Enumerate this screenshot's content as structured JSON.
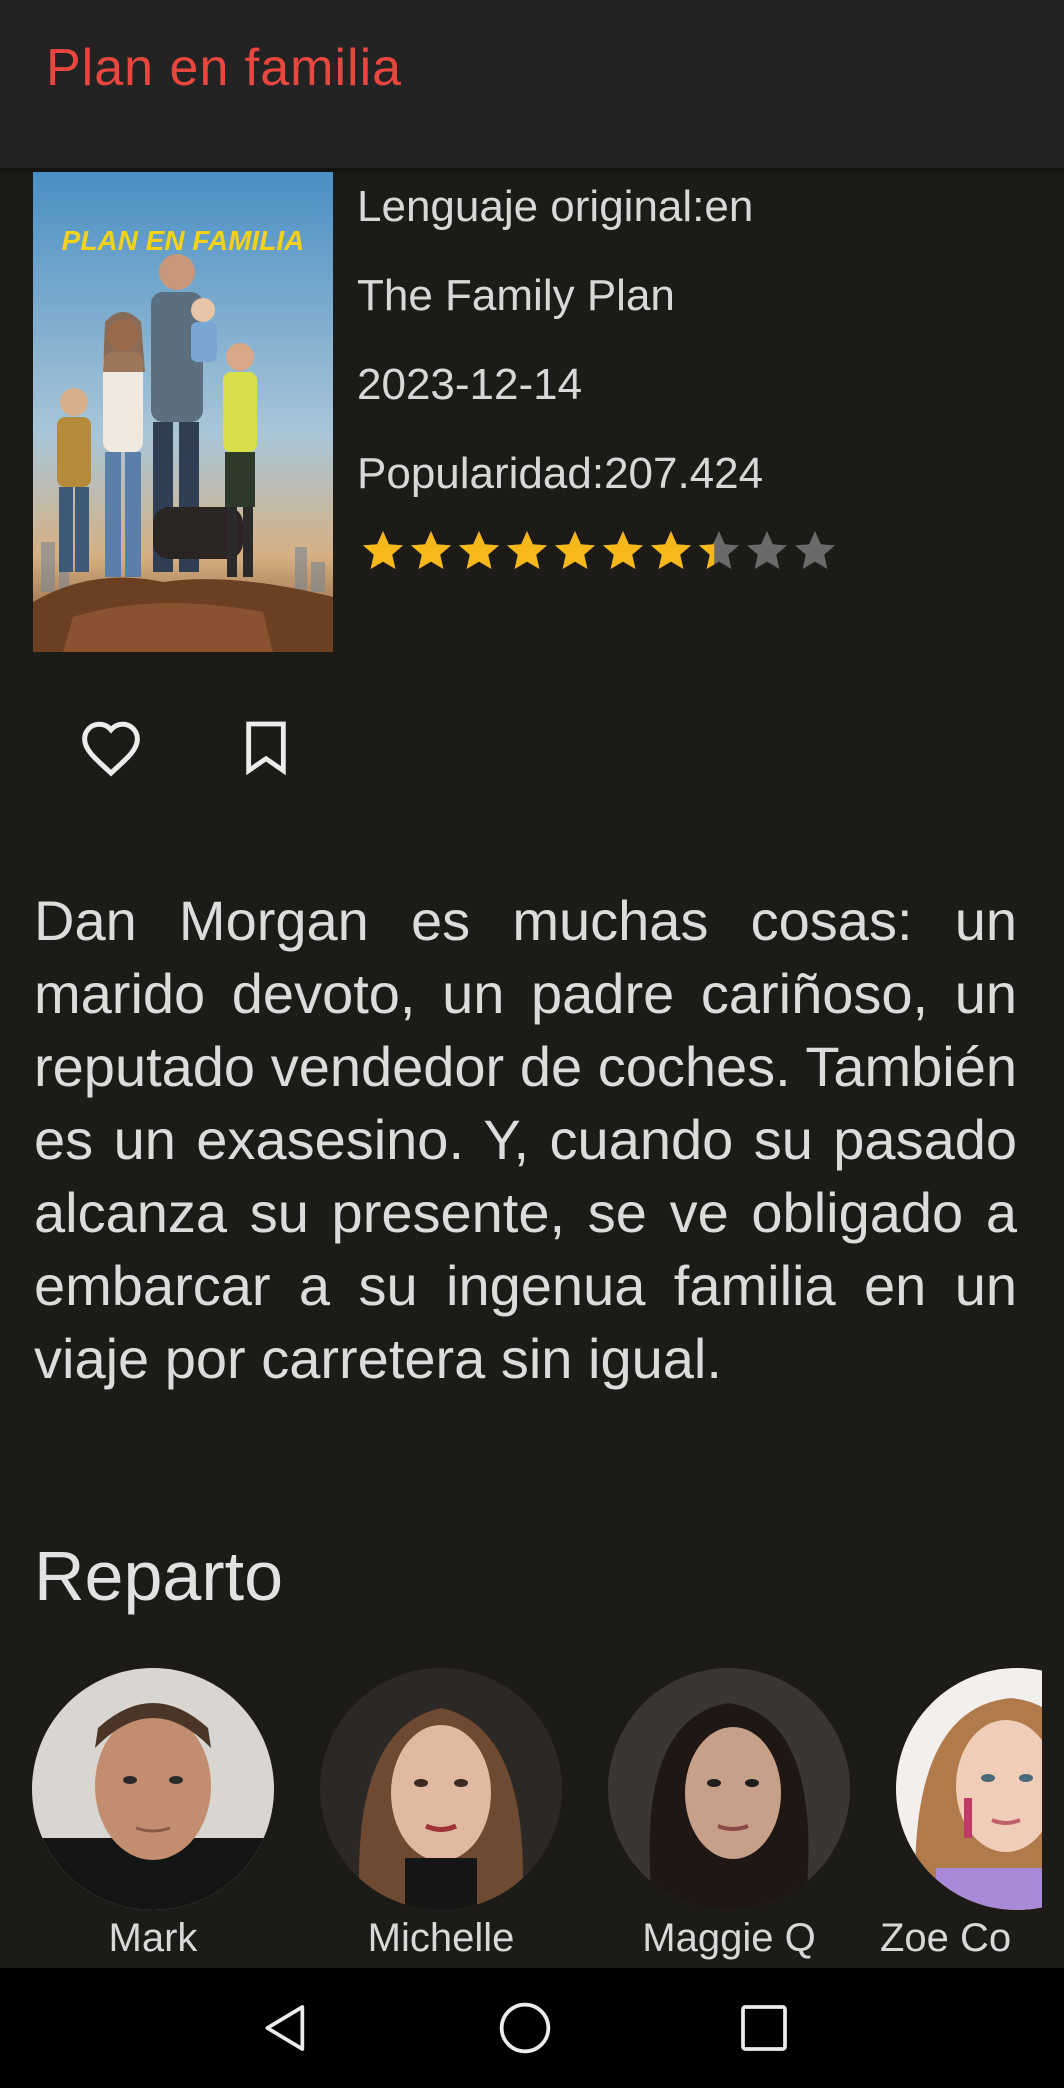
{
  "app_bar": {
    "title": "Plan en familia"
  },
  "movie": {
    "original_language": "Lenguaje original:en",
    "original_title": "The Family Plan",
    "release_date": "2023-12-14",
    "popularity": "Popularidad:207.424",
    "rating": 7.4,
    "rating_max": 10,
    "poster": {
      "title_text": "PLAN EN FAMILIA",
      "accent": "#f5d21a"
    },
    "overview": "Dan Morgan es muchas cosas: un marido devoto, un padre cariñoso, un reputado vendedor de coches. También es un exasesino. Y, cuando su pasado alcanza su presente, se ve obligado a embarcar a su ingenua familia en un viaje por carretera sin igual."
  },
  "actions": {
    "favorite_icon": "heart-outline-icon",
    "watchlist_icon": "bookmark-outline-icon"
  },
  "cast_section": {
    "title": "Reparto",
    "members": [
      {
        "name": "Mark"
      },
      {
        "name": "Michelle"
      },
      {
        "name": "Maggie Q"
      },
      {
        "name": "Zoe Co"
      }
    ]
  },
  "nav_bar": {
    "back_icon": "back-triangle-icon",
    "home_icon": "home-circle-icon",
    "recents_icon": "recents-square-icon"
  },
  "colors": {
    "accent": "#e8473f",
    "star_filled": "#f6b81a",
    "star_empty": "#6a6a6a",
    "background": "#1c1b18"
  }
}
